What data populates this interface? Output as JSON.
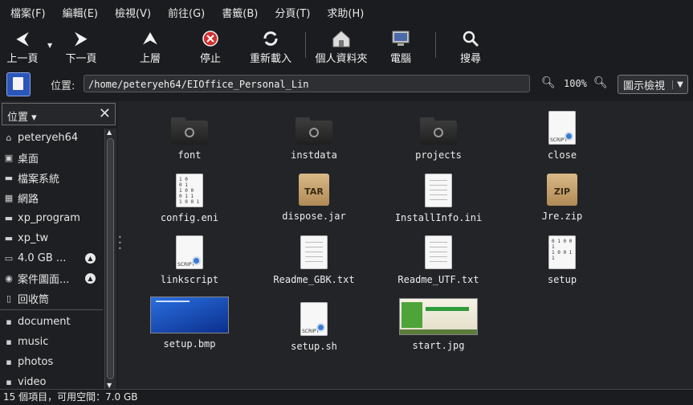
{
  "menu": [
    "檔案(F)",
    "編輯(E)",
    "檢視(V)",
    "前往(G)",
    "書籤(B)",
    "分頁(T)",
    "求助(H)"
  ],
  "toolbar": {
    "back": "上一頁",
    "forward": "下一頁",
    "up": "上層",
    "stop": "停止",
    "reload": "重新載入",
    "home": "個人資料夾",
    "computer": "電腦",
    "search": "搜尋"
  },
  "location": {
    "label": "位置:",
    "path": "/home/peteryeh64/EIOffice_Personal_Lin",
    "zoom": "100%",
    "view_mode": "圖示檢視"
  },
  "sidebar": {
    "title": "位置",
    "places": [
      {
        "label": "peteryeh64",
        "icon": "home-icon"
      },
      {
        "label": "桌面",
        "icon": "desktop-icon"
      },
      {
        "label": "檔案系統",
        "icon": "drive-icon"
      },
      {
        "label": "網路",
        "icon": "network-icon"
      },
      {
        "label": "xp_program",
        "icon": "drive-icon"
      },
      {
        "label": "xp_tw",
        "icon": "drive-icon"
      },
      {
        "label": "4.0 GB ...",
        "icon": "removable-drive-icon"
      },
      {
        "label": "案件圖面...",
        "icon": "optical-disc-icon"
      },
      {
        "label": "回收筒",
        "icon": "trash-icon"
      }
    ],
    "bookmarks": [
      {
        "label": "document"
      },
      {
        "label": "music"
      },
      {
        "label": "photos"
      },
      {
        "label": "video"
      }
    ]
  },
  "files": [
    {
      "name": "font",
      "type": "folder"
    },
    {
      "name": "instdata",
      "type": "folder"
    },
    {
      "name": "projects",
      "type": "folder"
    },
    {
      "name": "close",
      "type": "script"
    },
    {
      "name": "config.eni",
      "type": "binary"
    },
    {
      "name": "dispose.jar",
      "type": "tar"
    },
    {
      "name": "InstallInfo.ini",
      "type": "text"
    },
    {
      "name": "Jre.zip",
      "type": "zip"
    },
    {
      "name": "linkscript",
      "type": "script"
    },
    {
      "name": "Readme_GBK.txt",
      "type": "text"
    },
    {
      "name": "Readme_UTF.txt",
      "type": "text"
    },
    {
      "name": "setup",
      "type": "binary"
    },
    {
      "name": "setup.bmp",
      "type": "image-bmp"
    },
    {
      "name": "setup.sh",
      "type": "script"
    },
    {
      "name": "start.jpg",
      "type": "image-jpg"
    }
  ],
  "status": "15 個項目，可用空間：7.0 GB"
}
